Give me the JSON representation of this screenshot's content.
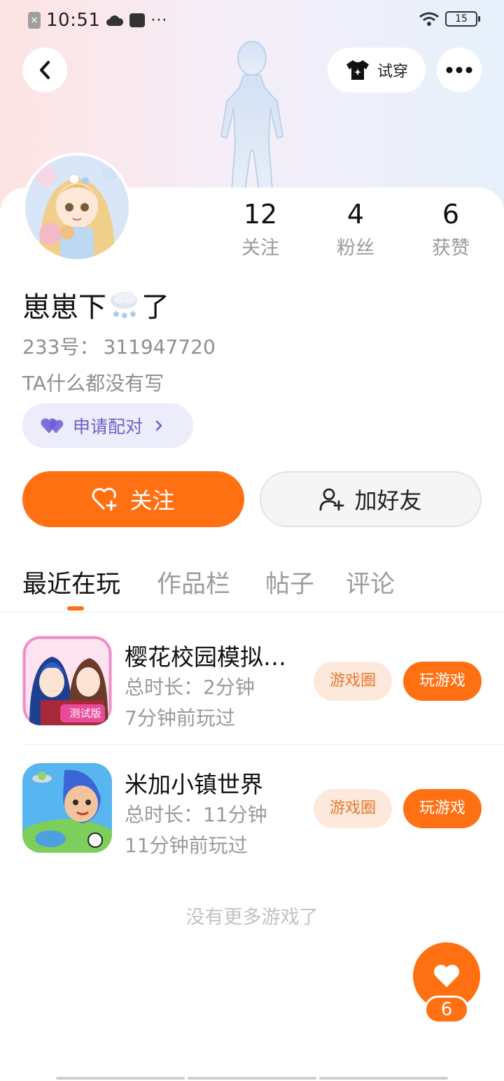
{
  "status_bar": {
    "time": "10:51",
    "more": "···",
    "battery": "15",
    "notification_x": "×"
  },
  "header": {
    "try_on_label": "试穿"
  },
  "profile": {
    "stats": [
      {
        "value": "12",
        "label": "关注"
      },
      {
        "value": "4",
        "label": "粉丝"
      },
      {
        "value": "6",
        "label": "获赞"
      }
    ],
    "nickname_before": "崽崽下",
    "nickname_emoji": "snow-cloud-emoji",
    "nickname_after": "了",
    "uid_label": "233号：",
    "uid_value": "311947720",
    "bio": "TA什么都没有写",
    "pair_button": "申请配对"
  },
  "actions": {
    "follow": "关注",
    "add_friend": "加好友"
  },
  "tabs": [
    "最近在玩",
    "作品栏",
    "帖子",
    "评论"
  ],
  "games": [
    {
      "name": "樱花校园模拟…",
      "total_time": "总时长：2分钟",
      "last_played": "7分钟前玩过",
      "badge": "测试版",
      "circle_label": "游戏圈",
      "play_label": "玩游戏"
    },
    {
      "name": "米加小镇世界",
      "total_time": "总时长：11分钟",
      "last_played": "11分钟前玩过",
      "circle_label": "游戏圈",
      "play_label": "玩游戏"
    }
  ],
  "footer": {
    "no_more": "没有更多游戏了",
    "like_count": "6"
  },
  "colors": {
    "accent": "#ff7012",
    "pair_bg": "#ececfb",
    "pair_text": "#6b63c9",
    "tag_bg": "#fde8dc"
  }
}
